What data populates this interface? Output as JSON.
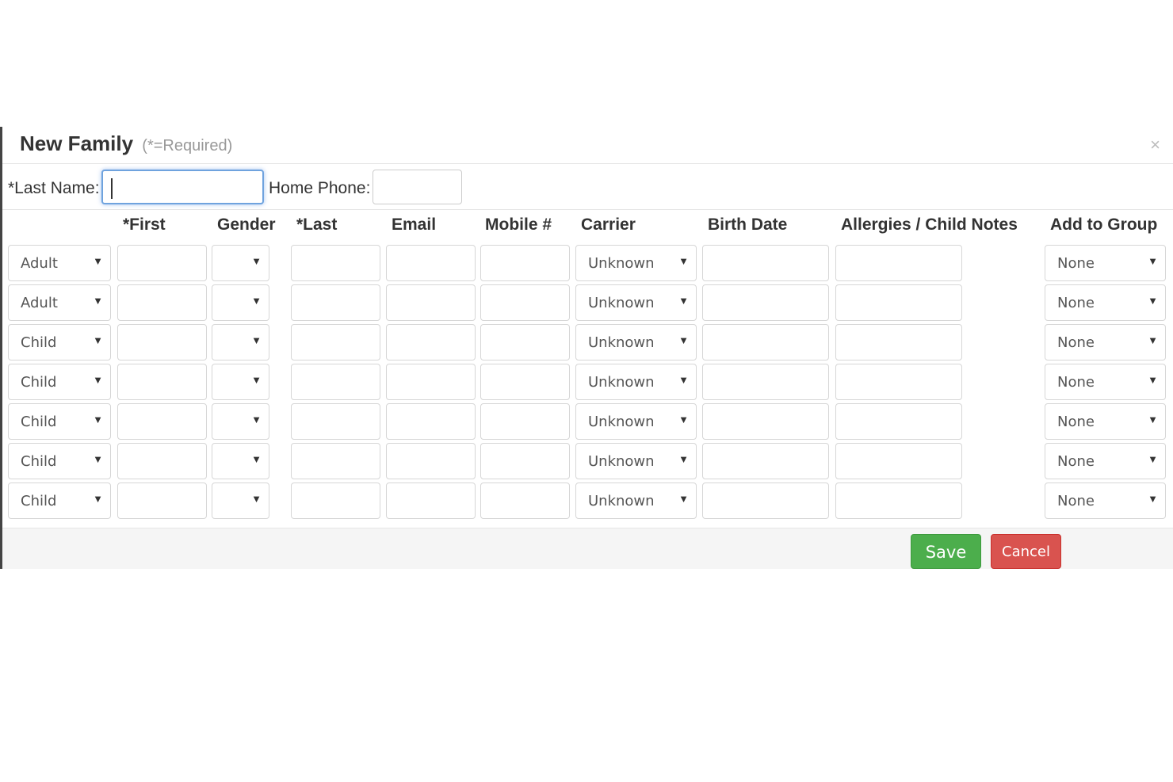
{
  "modal": {
    "title": "New Family",
    "required_note": "(*=Required)",
    "close_icon": "×"
  },
  "family": {
    "last_name_label": "*Last Name:",
    "last_name_value": "",
    "home_phone_label": "Home Phone:",
    "home_phone_value": ""
  },
  "columns": {
    "first": "*First",
    "gender": "Gender",
    "last": "*Last",
    "email": "Email",
    "mobile": "Mobile #",
    "carrier": "Carrier",
    "birth_date": "Birth Date",
    "notes": "Allergies / Child Notes",
    "group": "Add to Group"
  },
  "rows": [
    {
      "type": "Adult",
      "first": "",
      "gender": "",
      "last": "",
      "email": "",
      "mobile": "",
      "carrier": "Unknown",
      "birth_date": "",
      "notes": "",
      "group": "None"
    },
    {
      "type": "Adult",
      "first": "",
      "gender": "",
      "last": "",
      "email": "",
      "mobile": "",
      "carrier": "Unknown",
      "birth_date": "",
      "notes": "",
      "group": "None"
    },
    {
      "type": "Child",
      "first": "",
      "gender": "",
      "last": "",
      "email": "",
      "mobile": "",
      "carrier": "Unknown",
      "birth_date": "",
      "notes": "",
      "group": "None"
    },
    {
      "type": "Child",
      "first": "",
      "gender": "",
      "last": "",
      "email": "",
      "mobile": "",
      "carrier": "Unknown",
      "birth_date": "",
      "notes": "",
      "group": "None"
    },
    {
      "type": "Child",
      "first": "",
      "gender": "",
      "last": "",
      "email": "",
      "mobile": "",
      "carrier": "Unknown",
      "birth_date": "",
      "notes": "",
      "group": "None"
    },
    {
      "type": "Child",
      "first": "",
      "gender": "",
      "last": "",
      "email": "",
      "mobile": "",
      "carrier": "Unknown",
      "birth_date": "",
      "notes": "",
      "group": "None"
    },
    {
      "type": "Child",
      "first": "",
      "gender": "",
      "last": "",
      "email": "",
      "mobile": "",
      "carrier": "Unknown",
      "birth_date": "",
      "notes": "",
      "group": "None"
    }
  ],
  "icons": {
    "dropdown": "▼"
  },
  "footer": {
    "save_label": "Save",
    "cancel_label": "Cancel"
  },
  "colors": {
    "save": "#4cae4c",
    "cancel": "#d9534f",
    "focus": "#6fa3de"
  }
}
